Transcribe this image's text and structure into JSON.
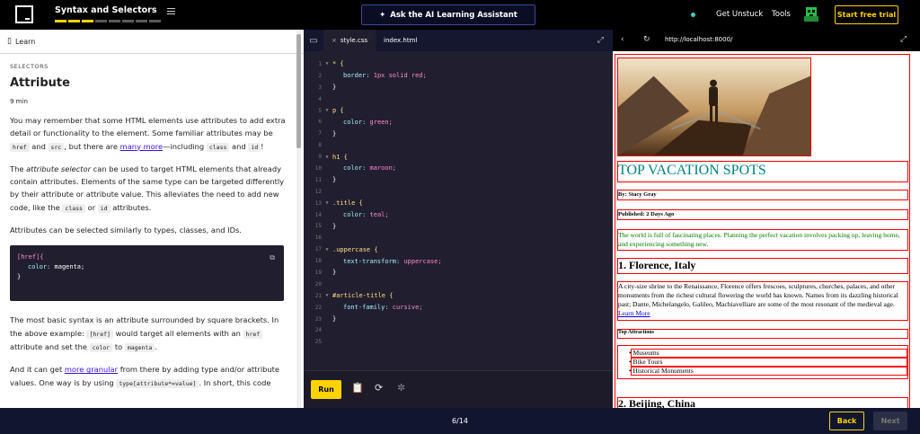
{
  "header": {
    "course_title": "Syntax and Selectors",
    "ai_button": "Ask the AI Learning Assistant",
    "get_unstuck": "Get Unstuck",
    "tools": "Tools",
    "trial": "Start free trial"
  },
  "lesson": {
    "panel_title": "Learn",
    "kicker": "SELECTORS",
    "title": "Attribute",
    "time": "9 min",
    "p1": {
      "a": "You may remember that some HTML elements use attributes to add extra detail or functionality to the element. Some familiar attributes may be ",
      "c1": "href",
      "b": " and ",
      "c2": "src",
      "c": ", but there are ",
      "link": "many more",
      "d": "—including ",
      "c3": "class",
      "e": " and ",
      "c4": "id",
      "f": "!"
    },
    "p2": {
      "a": "The ",
      "em": "attribute selector",
      "b": " can be used to target HTML elements that already contain attributes. Elements of the same type can be targeted differently by their attribute or attribute value. This alleviates the need to add new code, like the ",
      "c1": "class",
      "c": " or ",
      "c2": "id",
      "d": " attributes."
    },
    "p3": "Attributes can be selected similarly to types, classes, and IDs.",
    "code": {
      "l1": "[href]{",
      "l2prop": "color:",
      "l2val": " magenta;",
      "l3": "}"
    },
    "p4": {
      "a": "The most basic syntax is an attribute surrounded by square brackets. In the above example: ",
      "c1": "[href]",
      "b": " would target all elements with an ",
      "c2": "href",
      "c": " attribute and set the ",
      "c3": "color",
      "d": " to ",
      "c4": "magenta",
      "e": "."
    },
    "p5": {
      "a": "And it can get ",
      "link": "more granular",
      "b": " from there by adding type and/or attribute values. One way is by using ",
      "c1": "type[attribute*=value]",
      "c": ". In short, this code"
    }
  },
  "editor": {
    "tabs": [
      {
        "label": "style.css"
      },
      {
        "label": "index.html"
      }
    ],
    "run": "Run",
    "lines": [
      {
        "n": "1",
        "fold": true,
        "sel": "* {"
      },
      {
        "n": "2",
        "prop": "border:",
        "val": "1px solid red;"
      },
      {
        "n": "3",
        "punc": "}"
      },
      {
        "n": "4"
      },
      {
        "n": "5",
        "fold": true,
        "sel": "p {"
      },
      {
        "n": "6",
        "prop": "color:",
        "val": "green;"
      },
      {
        "n": "7",
        "punc": "}"
      },
      {
        "n": "8"
      },
      {
        "n": "9",
        "fold": true,
        "sel": "h1 {"
      },
      {
        "n": "10",
        "prop": "color:",
        "val": "maroon;"
      },
      {
        "n": "11",
        "punc": "}"
      },
      {
        "n": "12"
      },
      {
        "n": "13",
        "fold": true,
        "sel": ".title {"
      },
      {
        "n": "14",
        "prop": "color:",
        "val": "teal;"
      },
      {
        "n": "15",
        "punc": "}"
      },
      {
        "n": "16"
      },
      {
        "n": "17",
        "fold": true,
        "sel": ".uppercase {"
      },
      {
        "n": "18",
        "prop": "text-transform:",
        "val": "uppercase;"
      },
      {
        "n": "19",
        "punc": "}"
      },
      {
        "n": "20"
      },
      {
        "n": "21",
        "fold": true,
        "sel": "#article-title {"
      },
      {
        "n": "22",
        "prop": "font-family:",
        "val": "cursive;"
      },
      {
        "n": "23",
        "punc": "}"
      },
      {
        "n": "24"
      },
      {
        "n": "25"
      }
    ]
  },
  "browser": {
    "url": "http://localhost:8000/",
    "heading": "TOP VACATION SPOTS",
    "byline": "By: Stacy Gray",
    "published": "Published: 2 Days Ago",
    "intro": "The world is full of fascinating places. Planning the perfect vacation involves packing up, leaving home, and experiencing something new.",
    "h2": "1. Florence, Italy",
    "desc": "A city-size shrine to the Renaissance, Florence offers frescoes, sculptures, churches, palaces, and other monuments from the richest cultural flowering the world has known. Names from its dazzling historical past; Dante, Michelangelo, Galileo, Machiavelliare are some of the most resonant of the medieval age. ",
    "learn_more": "Learn More",
    "top_attr": "Top Attractions",
    "list": [
      "Museums",
      "Bike Tours",
      "Historical Monuments"
    ],
    "next_h2": "2. Beijing, China"
  },
  "footer": {
    "page": "6/14",
    "back": "Back",
    "next": "Next"
  }
}
